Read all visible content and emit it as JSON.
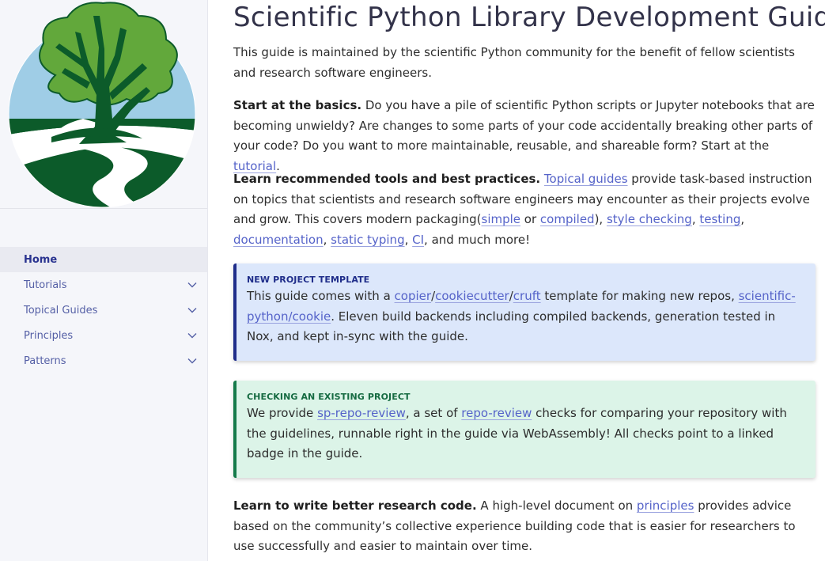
{
  "sidebar": {
    "nav": [
      {
        "label": "Home",
        "active": true,
        "expandable": false
      },
      {
        "label": "Tutorials",
        "active": false,
        "expandable": true
      },
      {
        "label": "Topical Guides",
        "active": false,
        "expandable": true
      },
      {
        "label": "Principles",
        "active": false,
        "expandable": true
      },
      {
        "label": "Patterns",
        "active": false,
        "expandable": true
      }
    ]
  },
  "page": {
    "title": "Scientific Python Library Development Guide",
    "intro": "This guide is maintained by the scientific Python community for the benefit of fellow scientists and research software engineers.",
    "basics": {
      "lead": "Start at the basics.",
      "text": " Do you have a pile of scientific Python scripts or Jupyter notebooks that are becoming unwieldy? Are changes to some parts of your code accidentally breaking other parts of your code? Do you want to more maintainable, reusable, and shareable form? Start at the ",
      "link": "tutorial",
      "end": "."
    },
    "tools": {
      "lead": "Learn recommended tools and best practices.",
      "space": " ",
      "link_topical": "Topical guides",
      "text1": " provide task-based instruction on topics that scientists and research software engineers may encounter as their projects evolve and grow. This covers modern packaging(",
      "link_simple": "simple",
      "or": " or ",
      "link_compiled": "compiled",
      "sep1": "), ",
      "link_style": "style checking",
      "sep2": ", ",
      "link_testing": "testing",
      "sep3": ", ",
      "link_docs": "documentation",
      "sep4": ", ",
      "link_typing": "static typing",
      "sep5": ", ",
      "link_ci": "CI",
      "end": ", and much more!"
    },
    "new_project": {
      "title": "NEW PROJECT TEMPLATE",
      "text1": "This guide comes with a ",
      "link_copier": "copier",
      "slash1": "/",
      "link_cookiecutter": "cookiecutter",
      "slash2": "/",
      "link_cruft": "cruft",
      "text2": " template for making new repos, ",
      "link_cookie": "scientific-python/cookie",
      "text3": ". Eleven build backends including compiled backends, generation tested in Nox, and kept in-sync with the guide."
    },
    "existing_project": {
      "title": "CHECKING AN EXISTING PROJECT",
      "text1": "We provide ",
      "link_sp": "sp-repo-review",
      "text2": ", a set of ",
      "link_rr": "repo-review",
      "text3": " checks for comparing your repository with the guidelines, runnable right in the guide via WebAssembly! All checks point to a linked badge in the guide."
    },
    "research": {
      "lead": "Learn to write better research code.",
      "text1": " A high-level document on ",
      "link": "principles",
      "text2": " provides advice based on the community’s collective experience building code that is easier for researchers to use successfully and easier to maintain over time."
    }
  },
  "colors": {
    "accent": "#5563c9",
    "nav_active": "#2a3490",
    "tree_light": "#62a83b",
    "tree_dark": "#0c5b2a",
    "sky": "#9fcde6",
    "card_blue": "#dce7fb",
    "card_green": "#dcf4e8"
  }
}
